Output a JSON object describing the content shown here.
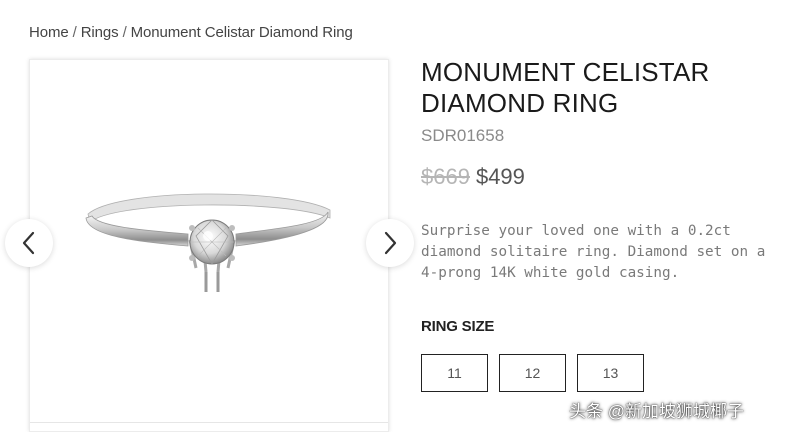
{
  "breadcrumb": {
    "items": [
      "Home",
      "Rings",
      "Monument Celistar Diamond Ring"
    ],
    "separator": "/"
  },
  "gallery": {
    "prev_icon": "chevron-left-icon",
    "next_icon": "chevron-right-icon"
  },
  "product": {
    "title_line1": "MONUMENT CELISTAR",
    "title_line2": "DIAMOND RING",
    "sku": "SDR01658",
    "price_original": "$669",
    "price_sale": "$499",
    "description_lines": [
      "Surprise your loved one with a 0.2ct",
      "diamond solitaire ring. Diamond set on a",
      "4-prong 14K white gold casing."
    ]
  },
  "ring_size": {
    "label": "RING SIZE",
    "options": [
      "11",
      "12",
      "13"
    ]
  },
  "watermark": "头条 @新加坡狮城椰子"
}
